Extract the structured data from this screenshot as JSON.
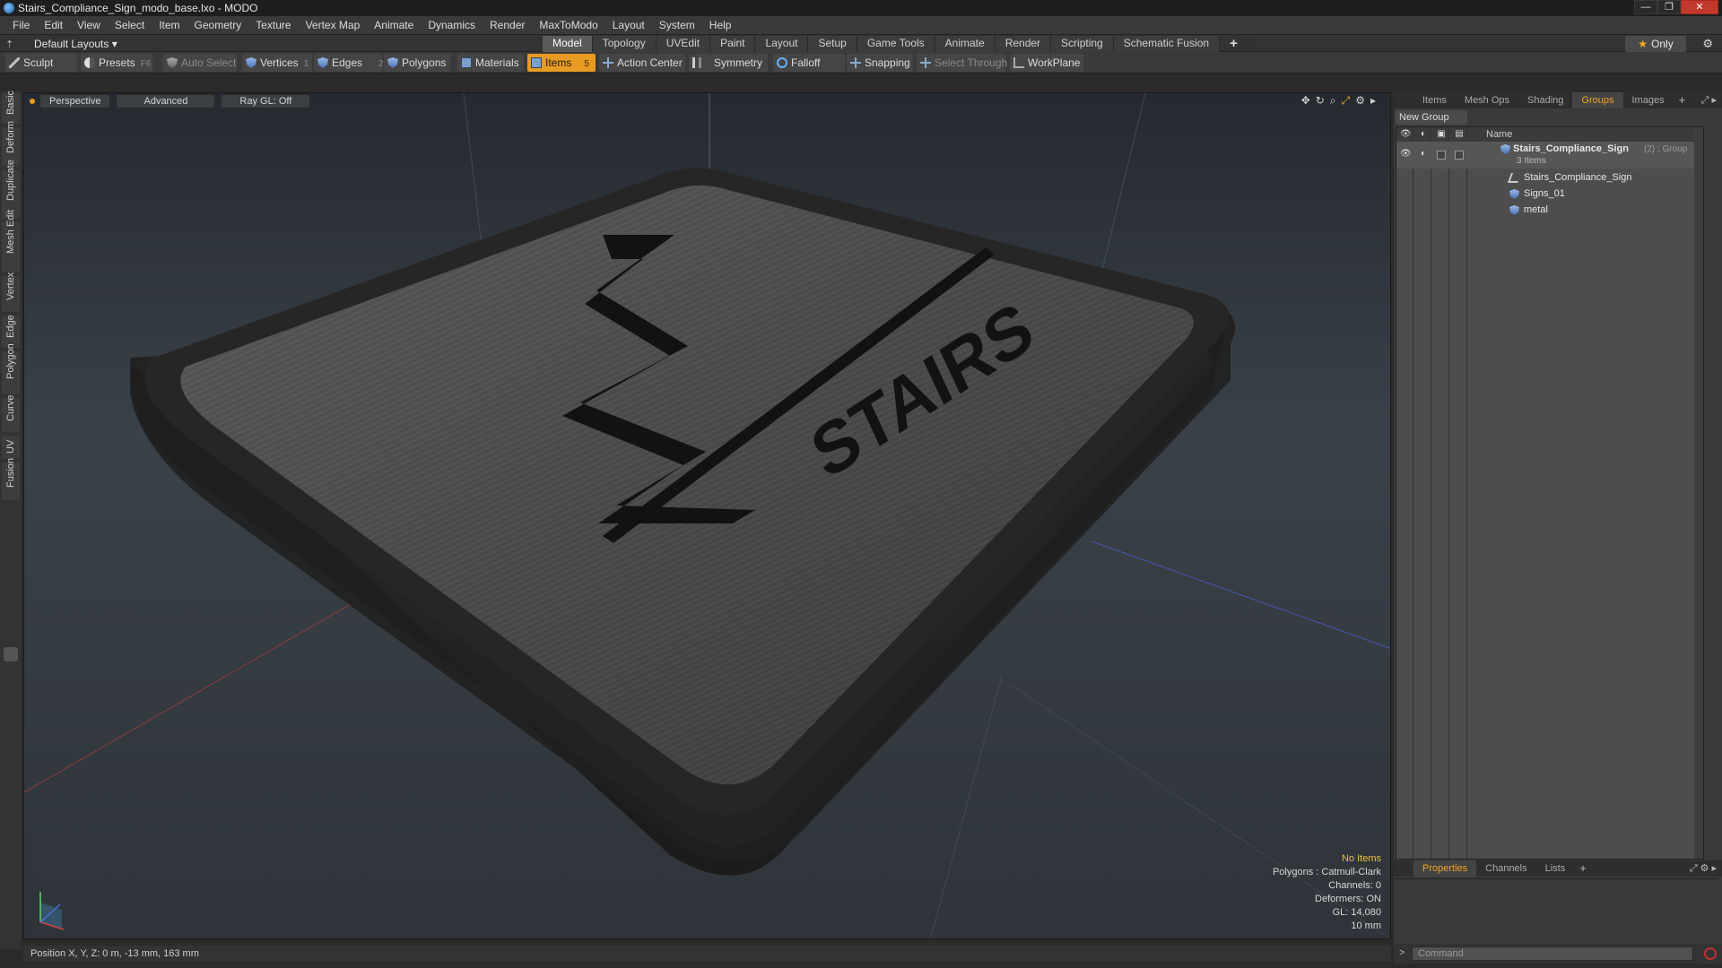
{
  "window": {
    "title": "Stairs_Compliance_Sign_modo_base.lxo - MODO",
    "controls": {
      "minimize": "—",
      "maximize": "❐",
      "close": "✕"
    }
  },
  "menu": [
    "File",
    "Edit",
    "View",
    "Select",
    "Item",
    "Geometry",
    "Texture",
    "Vertex Map",
    "Animate",
    "Dynamics",
    "Render",
    "MaxToModo",
    "Layout",
    "System",
    "Help"
  ],
  "layout_bar": {
    "layouts_label": "Default Layouts ▾",
    "tabs": [
      "Model",
      "Topology",
      "UVEdit",
      "Paint",
      "Layout",
      "Setup",
      "Game Tools",
      "Animate",
      "Render",
      "Scripting",
      "Schematic Fusion"
    ],
    "active_tab": "Model",
    "plus": "+",
    "only_label": "Only"
  },
  "toolbar": {
    "sculpt": "Sculpt",
    "presets": "Presets",
    "presets_key": "F6",
    "auto_select": "Auto Select",
    "vertices": "Vertices",
    "vertices_count": "1",
    "edges": "Edges",
    "edges_count": "2",
    "polygons": "Polygons",
    "materials": "Materials",
    "items": "Items",
    "items_count": "5",
    "action_center": "Action Center",
    "symmetry": "Symmetry",
    "falloff": "Falloff",
    "snapping": "Snapping",
    "select_through": "Select Through",
    "workplane": "WorkPlane"
  },
  "left_tabs": [
    "Basic",
    "Deform",
    "Duplicate",
    "Mesh Edit",
    "Vertex",
    "Edge",
    "Polygon",
    "Curve",
    "UV",
    "Fusion"
  ],
  "viewport": {
    "view": "Perspective",
    "shading": "Advanced",
    "raygl": "Ray GL: Off",
    "sign_text": "STAIRS",
    "info": {
      "selection": "No Items",
      "polygons": "Polygons : Catmull-Clark",
      "channels": "Channels: 0",
      "deformers": "Deformers: ON",
      "gl": "GL: 14,080",
      "scale": "10 mm"
    },
    "colors": {
      "selection_info": "#f0c040",
      "items_active": "#e89b22"
    }
  },
  "status": {
    "position": "Position X, Y, Z:  0 m, -13 mm, 163 mm"
  },
  "right_panel": {
    "tabs": [
      "Items",
      "Mesh Ops",
      "Shading",
      "Groups",
      "Images"
    ],
    "active_tab": "Groups",
    "new_group": "New Group",
    "column_name": "Name",
    "group": {
      "name": "Stairs_Compliance_Sign",
      "count": "(2)",
      "type": ": Group",
      "summary": "3 Items",
      "children": [
        "Stairs_Compliance_Sign",
        "Signs_01",
        "metal"
      ]
    },
    "bottom_tabs": [
      "Properties",
      "Channels",
      "Lists"
    ],
    "bottom_active": "Properties",
    "command_placeholder": "Command",
    "command_prompt": ">"
  }
}
